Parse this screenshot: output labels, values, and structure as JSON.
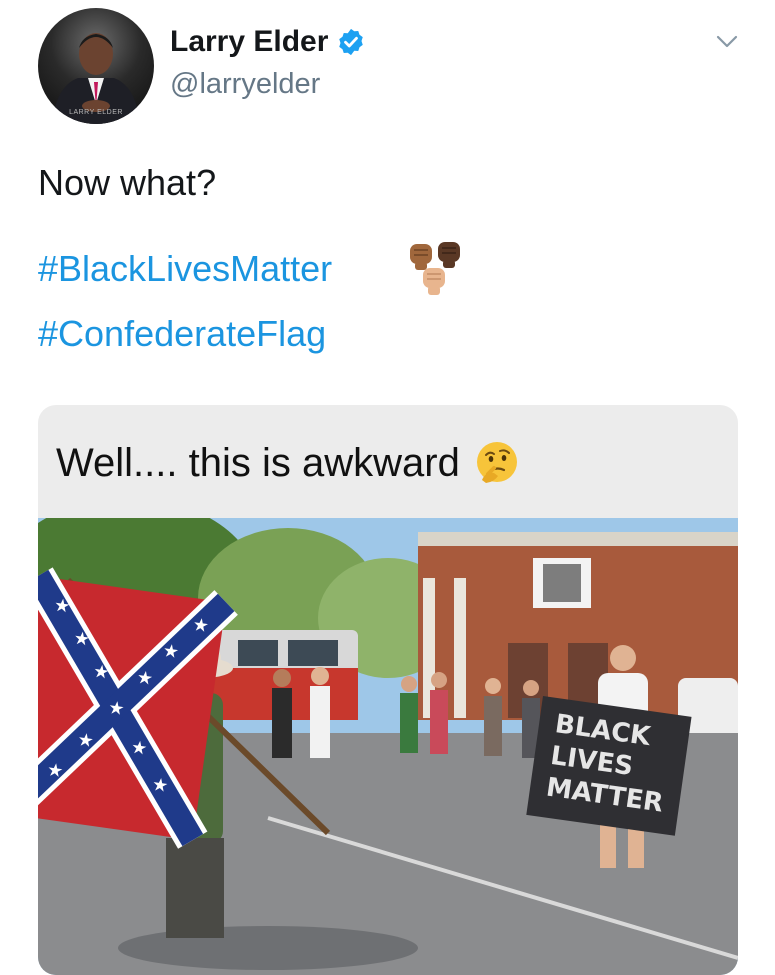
{
  "user": {
    "display_name": "Larry Elder",
    "handle": "@larryelder",
    "avatar_caption": "LARRY ELDER",
    "verified_color": "#1da1f2"
  },
  "tweet": {
    "text": "Now what?",
    "hashtags": [
      "#BlackLivesMatter",
      "#ConfederateFlag"
    ],
    "hashtag_color": "#1b95e0"
  },
  "media": {
    "caption": "Well.... this is awkward",
    "caption_emoji": "thinking-face-icon",
    "banner_text": [
      "BLACK",
      "LIVES",
      "MATTER"
    ]
  },
  "icons": {
    "verified": "verified-badge-icon",
    "menu": "chevron-down-icon",
    "hashtag_emoji": "raised-fists-icon"
  }
}
